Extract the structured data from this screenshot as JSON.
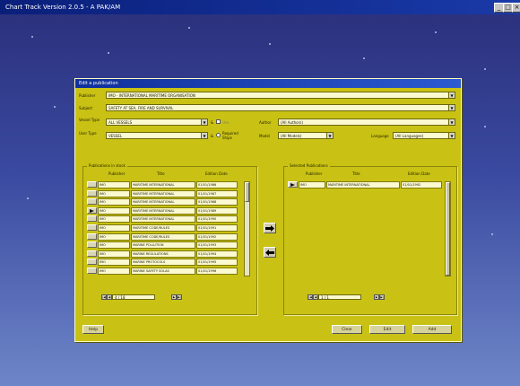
{
  "window": {
    "title": "Chart Track Version 2.0.5 - A PAK/AM",
    "controls": [
      "_",
      "□",
      "×"
    ]
  },
  "dialog": {
    "title": "Edit a publication",
    "publisher": {
      "label": "Publisher",
      "value": "IMO - INTERNATIONAL MARITIME ORGANISATION"
    },
    "subject": {
      "label": "Subject",
      "value": "SAFETY AT SEA, FIRE AND SURVIVAL"
    },
    "vessel_type": {
      "label": "Vessel Type",
      "value": "ALL VESSELS",
      "amp": "&"
    },
    "user_type": {
      "label": "User Type",
      "value": "VESSEL",
      "amp": "&"
    },
    "option_a": {
      "label": "Use"
    },
    "option_b": {
      "label": "Required Ships"
    },
    "author": {
      "label": "Author",
      "value": "(All Authors)"
    },
    "model": {
      "label": "Model",
      "value": "(All Models)"
    },
    "language": {
      "label": "Language",
      "value": "(All Languages)"
    }
  },
  "left_panel": {
    "title": "Publications in stock",
    "columns": [
      "Publisher",
      "Title",
      "Edition Date"
    ],
    "rows": [
      {
        "publisher": "IMO",
        "title": "MARITIME INTERNATIONAL",
        "date": "01/01/1986"
      },
      {
        "publisher": "IMO",
        "title": "MARITIME INTERNATIONAL",
        "date": "01/01/1987"
      },
      {
        "publisher": "IMO",
        "title": "MARITIME INTERNATIONAL",
        "date": "01/01/1988"
      },
      {
        "publisher": "IMO",
        "title": "MARITIME INTERNATIONAL",
        "date": "01/01/1989"
      },
      {
        "publisher": "IMO",
        "title": "MARITIME INTERNATIONAL",
        "date": "01/01/1990"
      },
      {
        "publisher": "IMO",
        "title": "MARITIME CODE/RULES",
        "date": "01/01/1991"
      },
      {
        "publisher": "IMO",
        "title": "MARITIME CODE/RULES",
        "date": "01/01/1992"
      },
      {
        "publisher": "IMO",
        "title": "MARINE POLLUTION",
        "date": "01/01/1993"
      },
      {
        "publisher": "IMO",
        "title": "MARINE REGULATIONS",
        "date": "01/01/1994"
      },
      {
        "publisher": "IMO",
        "title": "MARINE PROTOCOLS",
        "date": "01/01/1995"
      },
      {
        "publisher": "IMO",
        "title": "MARINE SAFETY SOLAS",
        "date": "01/01/1996"
      }
    ],
    "selected_row": 3,
    "record_nav": "4 / 18"
  },
  "right_panel": {
    "title": "Selected Publications",
    "columns": [
      "Publisher",
      "Title",
      "Edition Date"
    ],
    "rows": [
      {
        "publisher": "IMO",
        "title": "MARITIME INTERNATIONAL",
        "date": "01/01/1992"
      }
    ],
    "record_nav": "1 / 1"
  },
  "buttons": {
    "help": "Help",
    "clear": "Clear",
    "edit": "Edit",
    "add": "Add"
  },
  "icons": {
    "move_right": "arrow-right-icon",
    "move_left": "arrow-left-icon"
  }
}
